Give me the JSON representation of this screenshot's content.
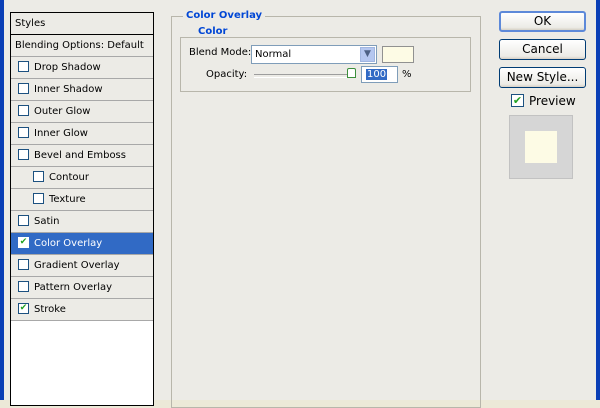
{
  "styles_panel": {
    "header": "Styles",
    "items": [
      {
        "label": "Blending Options: Default",
        "checkbox": false,
        "checked": false,
        "sub": false,
        "selected": false
      },
      {
        "label": "Drop Shadow",
        "checkbox": true,
        "checked": false,
        "sub": false,
        "selected": false
      },
      {
        "label": "Inner Shadow",
        "checkbox": true,
        "checked": false,
        "sub": false,
        "selected": false
      },
      {
        "label": "Outer Glow",
        "checkbox": true,
        "checked": false,
        "sub": false,
        "selected": false
      },
      {
        "label": "Inner Glow",
        "checkbox": true,
        "checked": false,
        "sub": false,
        "selected": false
      },
      {
        "label": "Bevel and Emboss",
        "checkbox": true,
        "checked": false,
        "sub": false,
        "selected": false
      },
      {
        "label": "Contour",
        "checkbox": true,
        "checked": false,
        "sub": true,
        "selected": false
      },
      {
        "label": "Texture",
        "checkbox": true,
        "checked": false,
        "sub": true,
        "selected": false
      },
      {
        "label": "Satin",
        "checkbox": true,
        "checked": false,
        "sub": false,
        "selected": false
      },
      {
        "label": "Color Overlay",
        "checkbox": true,
        "checked": true,
        "sub": false,
        "selected": true
      },
      {
        "label": "Gradient Overlay",
        "checkbox": true,
        "checked": false,
        "sub": false,
        "selected": false
      },
      {
        "label": "Pattern Overlay",
        "checkbox": true,
        "checked": false,
        "sub": false,
        "selected": false
      },
      {
        "label": "Stroke",
        "checkbox": true,
        "checked": true,
        "sub": false,
        "selected": false
      }
    ]
  },
  "panel": {
    "title": "Color Overlay",
    "group_title": "Color",
    "blend_mode_label": "Blend Mode:",
    "blend_mode_value": "Normal",
    "overlay_color": "#fdfbe5",
    "opacity_label": "Opacity:",
    "opacity_value": "100",
    "opacity_unit": "%",
    "opacity_fraction": 1.0
  },
  "buttons": {
    "ok": "OK",
    "cancel": "Cancel",
    "new_style": "New Style..."
  },
  "preview": {
    "label": "Preview",
    "checked": true
  },
  "colors": {
    "accent": "#316ac5",
    "group_title": "#0046d5",
    "check": "#21a121"
  }
}
